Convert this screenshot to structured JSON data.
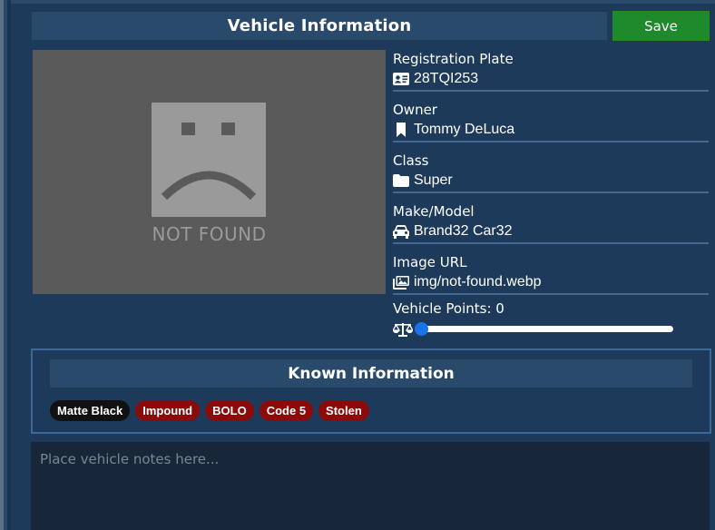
{
  "header": {
    "title": "Vehicle Information",
    "save_label": "Save"
  },
  "image": {
    "placeholder_text": "NOT FOUND"
  },
  "fields": [
    {
      "label": "Registration Plate",
      "value": "28TQI253",
      "icon": "id-card-icon"
    },
    {
      "label": "Owner",
      "value": "Tommy DeLuca",
      "icon": "bookmark-icon"
    },
    {
      "label": "Class",
      "value": "Super",
      "icon": "folder-icon"
    },
    {
      "label": "Make/Model",
      "value": "Brand32 Car32",
      "icon": "car-icon"
    },
    {
      "label": "Image URL",
      "value": "img/not-found.webp",
      "icon": "images-icon"
    }
  ],
  "points": {
    "label": "Vehicle Points: 0",
    "value": 0,
    "icon": "scale-balance-icon"
  },
  "known": {
    "title": "Known Information",
    "tags": [
      {
        "label": "Matte Black",
        "color": "#111111"
      },
      {
        "label": "Impound",
        "color": "#8b0b0b"
      },
      {
        "label": "BOLO",
        "color": "#8b0b0b"
      },
      {
        "label": "Code 5",
        "color": "#8b0b0b"
      },
      {
        "label": "Stolen",
        "color": "#8b0b0b"
      }
    ]
  },
  "notes": {
    "placeholder": "Place vehicle notes here...",
    "value": ""
  },
  "colors": {
    "background": "#1e3a5a",
    "header": "#2a4a6b",
    "save": "#1e8a2b",
    "tag_red": "#8b0b0b",
    "slider": "#1a73e8"
  }
}
